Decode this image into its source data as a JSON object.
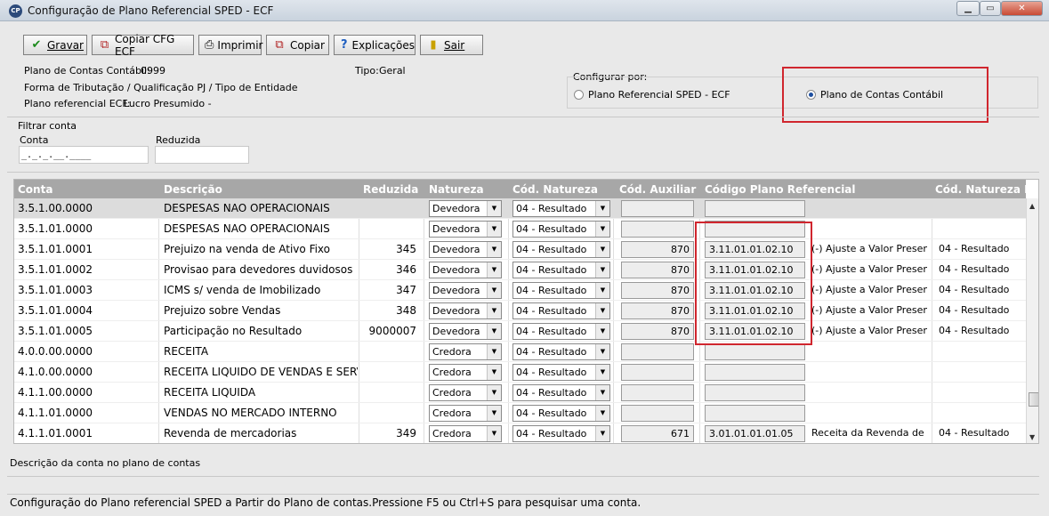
{
  "window": {
    "title": "Configuração de Plano Referencial SPED - ECF",
    "app_icon": "CP"
  },
  "toolbar": {
    "gravar": "Gravar",
    "copiar_cfg": "Copiar CFG ECF",
    "imprimir": "Imprimir",
    "copiar": "Copiar",
    "explicacoes": "Explicações",
    "sair": "Sair"
  },
  "info": {
    "plano_label": "Plano de Contas Contábil:",
    "plano_value": "0999",
    "tipo_label": "Tipo:",
    "tipo_value": "Geral",
    "forma_label": "Forma de Tributação / Qualificação PJ / Tipo de Entidade",
    "ecf_label": "Plano referencial ECF:",
    "ecf_value": "Lucro Presumido -"
  },
  "config": {
    "label": "Configurar por:",
    "option_sped": "Plano Referencial SPED - ECF",
    "option_contabil": "Plano de Contas Contábil",
    "selected": "Plano de Contas Contábil"
  },
  "filter": {
    "title": "Filtrar conta",
    "conta_label": "Conta",
    "conta_value": "_._._.__.____",
    "reduzida_label": "Reduzida",
    "reduzida_value": ""
  },
  "grid": {
    "columns": [
      "Conta",
      "Descrição",
      "Reduzida",
      "Natureza",
      "Cód. Natureza",
      "Cód. Auxiliar",
      "Código Plano Referencial",
      "Cód. Natureza ECF"
    ],
    "rows": [
      {
        "conta": "3.5.1.00.0000",
        "descricao": "DESPESAS NAO OPERACIONAIS",
        "reduzida": "",
        "natureza": "Devedora",
        "cod_natureza": "04 - Resultado",
        "cod_auxiliar": "",
        "cod_ref": "",
        "ref_desc": "",
        "nat_ecf": ""
      },
      {
        "conta": "3.5.1.01.0000",
        "descricao": "DESPESAS NAO OPERACIONAIS",
        "reduzida": "",
        "natureza": "Devedora",
        "cod_natureza": "04 - Resultado",
        "cod_auxiliar": "",
        "cod_ref": "",
        "ref_desc": "",
        "nat_ecf": ""
      },
      {
        "conta": "3.5.1.01.0001",
        "descricao": "Prejuizo na venda de Ativo Fixo",
        "reduzida": "345",
        "natureza": "Devedora",
        "cod_natureza": "04 - Resultado",
        "cod_auxiliar": "870",
        "cod_ref": "3.11.01.01.02.10",
        "ref_desc": "(-) Ajuste a Valor Presente s",
        "nat_ecf": "04 - Resultado"
      },
      {
        "conta": "3.5.1.01.0002",
        "descricao": "Provisao para devedores duvidosos",
        "reduzida": "346",
        "natureza": "Devedora",
        "cod_natureza": "04 - Resultado",
        "cod_auxiliar": "870",
        "cod_ref": "3.11.01.01.02.10",
        "ref_desc": "(-) Ajuste a Valor Presente s",
        "nat_ecf": "04 - Resultado"
      },
      {
        "conta": "3.5.1.01.0003",
        "descricao": "ICMS s/ venda de Imobilizado",
        "reduzida": "347",
        "natureza": "Devedora",
        "cod_natureza": "04 - Resultado",
        "cod_auxiliar": "870",
        "cod_ref": "3.11.01.01.02.10",
        "ref_desc": "(-) Ajuste a Valor Presente s",
        "nat_ecf": "04 - Resultado"
      },
      {
        "conta": "3.5.1.01.0004",
        "descricao": "Prejuizo sobre Vendas",
        "reduzida": "348",
        "natureza": "Devedora",
        "cod_natureza": "04 - Resultado",
        "cod_auxiliar": "870",
        "cod_ref": "3.11.01.01.02.10",
        "ref_desc": "(-) Ajuste a Valor Presente s",
        "nat_ecf": "04 - Resultado"
      },
      {
        "conta": "3.5.1.01.0005",
        "descricao": "Participação no Resultado",
        "reduzida": "9000007",
        "natureza": "Devedora",
        "cod_natureza": "04 - Resultado",
        "cod_auxiliar": "870",
        "cod_ref": "3.11.01.01.02.10",
        "ref_desc": "(-) Ajuste a Valor Presente s",
        "nat_ecf": "04 - Resultado"
      },
      {
        "conta": "4.0.0.00.0000",
        "descricao": "RECEITA",
        "reduzida": "",
        "natureza": "Credora",
        "cod_natureza": "04 - Resultado",
        "cod_auxiliar": "",
        "cod_ref": "",
        "ref_desc": "",
        "nat_ecf": ""
      },
      {
        "conta": "4.1.0.00.0000",
        "descricao": "RECEITA LIQUIDO DE VENDAS E SERVICO",
        "reduzida": "",
        "natureza": "Credora",
        "cod_natureza": "04 - Resultado",
        "cod_auxiliar": "",
        "cod_ref": "",
        "ref_desc": "",
        "nat_ecf": ""
      },
      {
        "conta": "4.1.1.00.0000",
        "descricao": "RECEITA LIQUIDA",
        "reduzida": "",
        "natureza": "Credora",
        "cod_natureza": "04 - Resultado",
        "cod_auxiliar": "",
        "cod_ref": "",
        "ref_desc": "",
        "nat_ecf": ""
      },
      {
        "conta": "4.1.1.01.0000",
        "descricao": "VENDAS NO MERCADO INTERNO",
        "reduzida": "",
        "natureza": "Credora",
        "cod_natureza": "04 - Resultado",
        "cod_auxiliar": "",
        "cod_ref": "",
        "ref_desc": "",
        "nat_ecf": ""
      },
      {
        "conta": "4.1.1.01.0001",
        "descricao": "Revenda de mercadorias",
        "reduzida": "349",
        "natureza": "Credora",
        "cod_natureza": "04 - Resultado",
        "cod_auxiliar": "671",
        "cod_ref": "3.01.01.01.01.05",
        "ref_desc": "Receita da Revenda de Me",
        "nat_ecf": "04 - Resultado"
      }
    ]
  },
  "description_panel": "Descrição da conta no plano de contas",
  "statusbar": "Configuração do Plano referencial SPED a Partir do Plano de contas.Pressione F5 ou Ctrl+S para pesquisar uma conta.",
  "colors": {
    "highlight_red": "#d0262e",
    "header_gray": "#a7a7a7"
  }
}
